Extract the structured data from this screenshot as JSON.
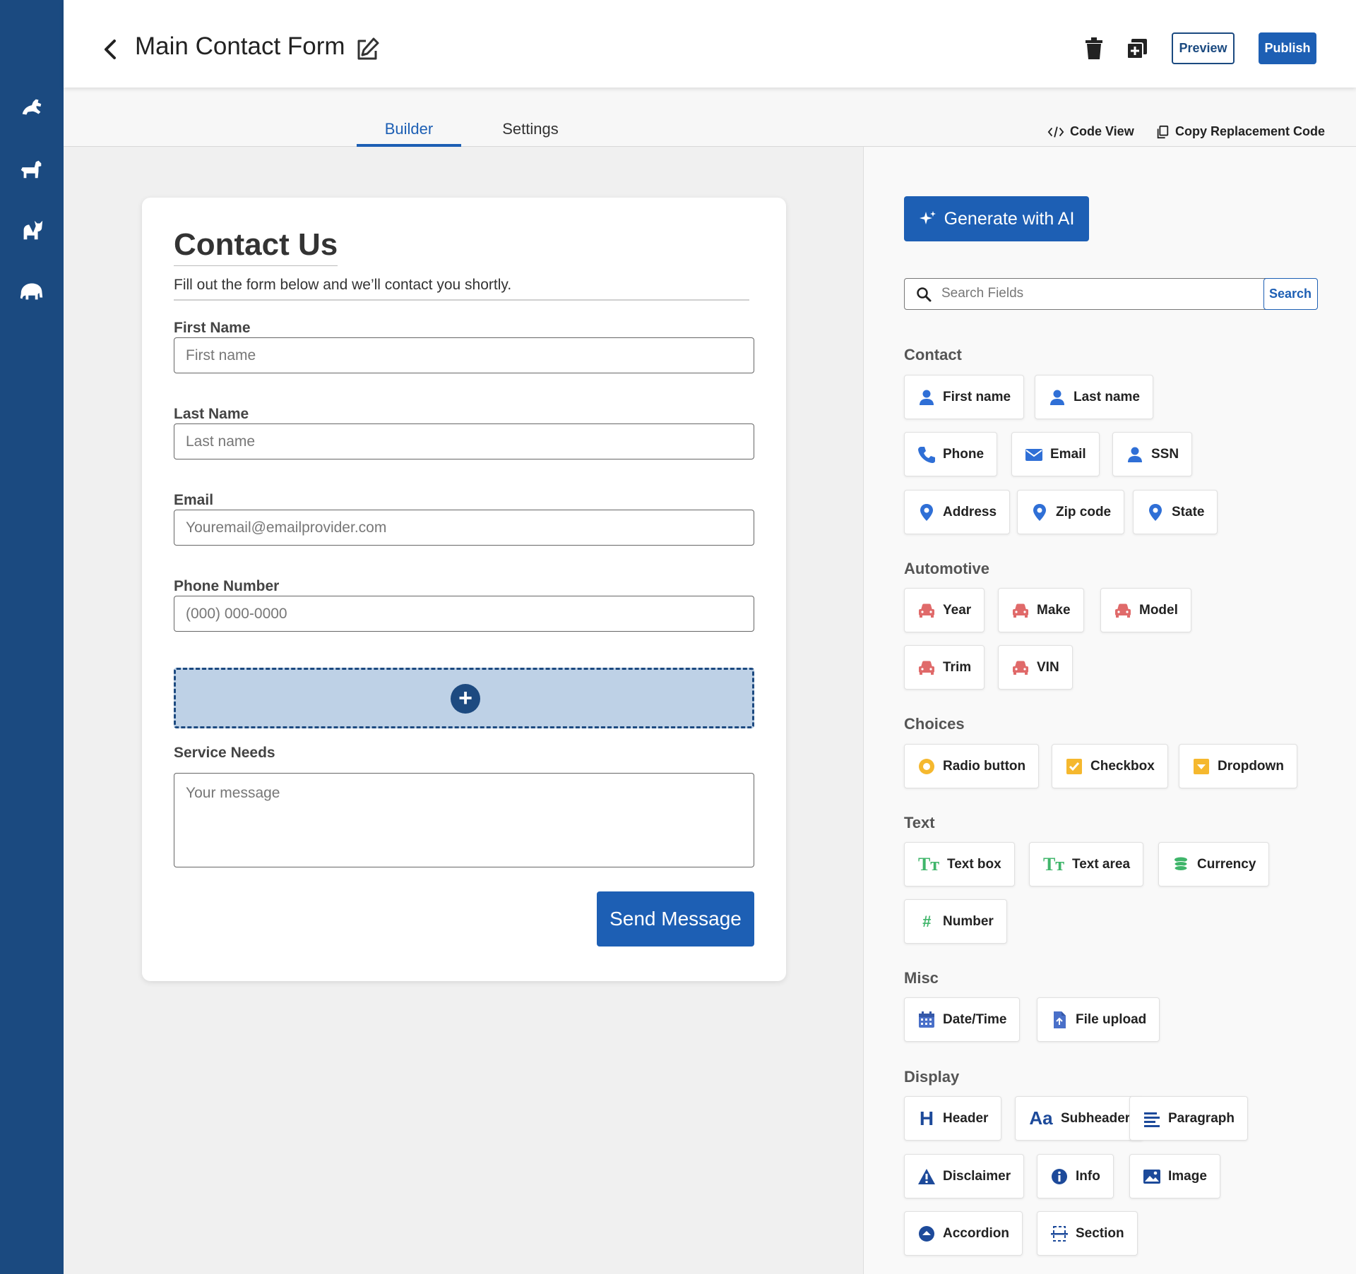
{
  "header": {
    "title": "Main Contact Form",
    "preview_label": "Preview",
    "publish_label": "Publish"
  },
  "tabs": {
    "builder": "Builder",
    "settings": "Settings",
    "code_view": "Code View",
    "copy_code": "Copy Replacement Code"
  },
  "form": {
    "title": "Contact Us",
    "subtitle": "Fill out the form below and we’ll contact you shortly.",
    "fields": {
      "first_name": {
        "label": "First Name",
        "placeholder": "First name"
      },
      "last_name": {
        "label": "Last Name",
        "placeholder": "Last name"
      },
      "email": {
        "label": "Email",
        "placeholder": "Youremail@emailprovider.com"
      },
      "phone": {
        "label": "Phone Number",
        "placeholder": "(000) 000-0000"
      },
      "service": {
        "label": "Service Needs",
        "placeholder": "Your message"
      }
    },
    "drop_zone_symbol": "+",
    "submit_label": "Send Message"
  },
  "panel": {
    "ai_label": "Generate with AI",
    "search_placeholder": "Search Fields",
    "search_button": "Search",
    "sections": {
      "contact": "Contact",
      "automotive": "Automotive",
      "choices": "Choices",
      "text": "Text",
      "misc": "Misc",
      "display": "Display"
    },
    "chips": {
      "first_name": "First name",
      "last_name": "Last name",
      "phone": "Phone",
      "email": "Email",
      "ssn": "SSN",
      "address": "Address",
      "zip": "Zip code",
      "state": "State",
      "year": "Year",
      "make": "Make",
      "model": "Model",
      "trim": "Trim",
      "vin": "VIN",
      "radio": "Radio button",
      "checkbox": "Checkbox",
      "dropdown": "Dropdown",
      "textbox": "Text box",
      "textarea": "Text area",
      "currency": "Currency",
      "number": "Number",
      "datetime": "Date/Time",
      "fileupload": "File upload",
      "header": "Header",
      "subheader": "Subheader",
      "paragraph": "Paragraph",
      "disclaimer": "Disclaimer",
      "info": "Info",
      "image": "Image",
      "accordion": "Accordion",
      "section": "Section"
    }
  },
  "colors": {
    "rail": "#1b4a80",
    "accent": "#1d5fb4",
    "contact_icon": "#2f6fd6",
    "auto_icon": "#e06a6a",
    "choice_icon": "#f5b82e",
    "text_icon": "#3fb56a",
    "display_icon": "#1d4a9a"
  },
  "icons": {
    "rail": [
      "horse-icon",
      "dog-icon",
      "cat-icon",
      "elephant-icon"
    ],
    "text_glyph": "Tт",
    "number_glyph": "#",
    "subheader_glyph": "Aa",
    "header_glyph": "H"
  }
}
